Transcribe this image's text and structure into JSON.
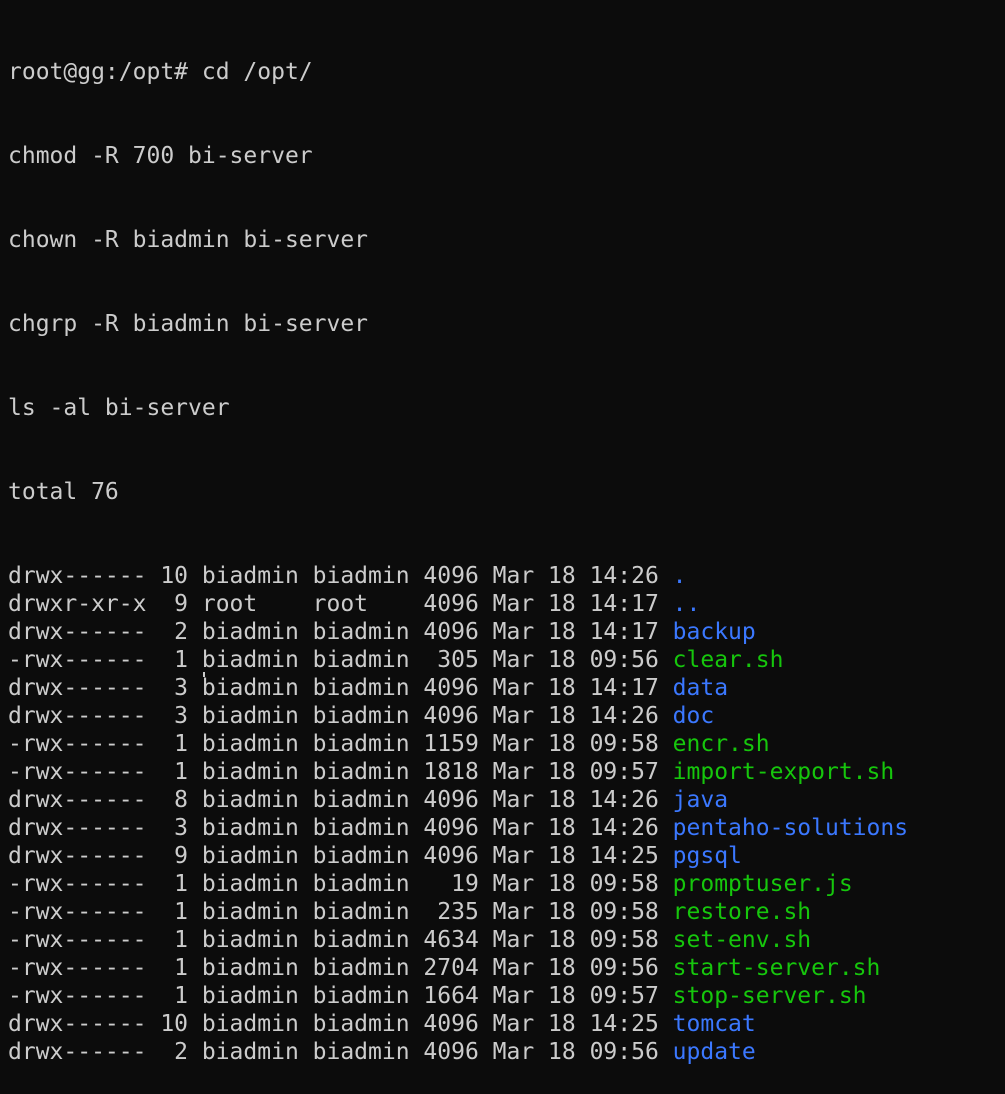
{
  "colors": {
    "background": "#0c0c0c",
    "text": "#cccccc",
    "directory": "#3b78ff",
    "executable": "#16c60c"
  },
  "terminal": {
    "prompt_line": "root@gg:/opt# cd /opt/",
    "commands": [
      "chmod -R 700 bi-server",
      "chown -R biadmin bi-server",
      "chgrp -R biadmin bi-server",
      "ls -al bi-server"
    ],
    "total_line": "total 76",
    "entries": [
      {
        "meta": "drwx------ 10 biadmin biadmin 4096 Mar 18 14:26 ",
        "name": ".",
        "type": "dir"
      },
      {
        "meta": "drwxr-xr-x  9 root    root    4096 Mar 18 14:17 ",
        "name": "..",
        "type": "dir"
      },
      {
        "meta": "drwx------  2 biadmin biadmin 4096 Mar 18 14:17 ",
        "name": "backup",
        "type": "dir"
      },
      {
        "meta": "-rwx------  1 biadmin biadmin  305 Mar 18 09:56 ",
        "name": "clear.sh",
        "type": "exec"
      },
      {
        "meta": "drwx------  3 biadmin biadmin 4096 Mar 18 14:17 ",
        "name": "data",
        "type": "dir"
      },
      {
        "meta": "drwx------  3 biadmin biadmin 4096 Mar 18 14:26 ",
        "name": "doc",
        "type": "dir"
      },
      {
        "meta": "-rwx------  1 biadmin biadmin 1159 Mar 18 09:58 ",
        "name": "encr.sh",
        "type": "exec"
      },
      {
        "meta": "-rwx------  1 biadmin biadmin 1818 Mar 18 09:57 ",
        "name": "import-export.sh",
        "type": "exec"
      },
      {
        "meta": "drwx------  8 biadmin biadmin 4096 Mar 18 14:26 ",
        "name": "java",
        "type": "dir"
      },
      {
        "meta": "drwx------  3 biadmin biadmin 4096 Mar 18 14:26 ",
        "name": "pentaho-solutions",
        "type": "dir"
      },
      {
        "meta": "drwx------  9 biadmin biadmin 4096 Mar 18 14:25 ",
        "name": "pgsql",
        "type": "dir"
      },
      {
        "meta": "-rwx------  1 biadmin biadmin   19 Mar 18 09:58 ",
        "name": "promptuser.js",
        "type": "exec"
      },
      {
        "meta": "-rwx------  1 biadmin biadmin  235 Mar 18 09:58 ",
        "name": "restore.sh",
        "type": "exec"
      },
      {
        "meta": "-rwx------  1 biadmin biadmin 4634 Mar 18 09:58 ",
        "name": "set-env.sh",
        "type": "exec"
      },
      {
        "meta": "-rwx------  1 biadmin biadmin 2704 Mar 18 09:56 ",
        "name": "start-server.sh",
        "type": "exec"
      },
      {
        "meta": "-rwx------  1 biadmin biadmin 1664 Mar 18 09:57 ",
        "name": "stop-server.sh",
        "type": "exec"
      },
      {
        "meta": "drwx------ 10 biadmin biadmin 4096 Mar 18 14:25 ",
        "name": "tomcat",
        "type": "dir"
      },
      {
        "meta": "drwx------  2 biadmin biadmin 4096 Mar 18 09:56 ",
        "name": "update",
        "type": "dir"
      }
    ]
  }
}
